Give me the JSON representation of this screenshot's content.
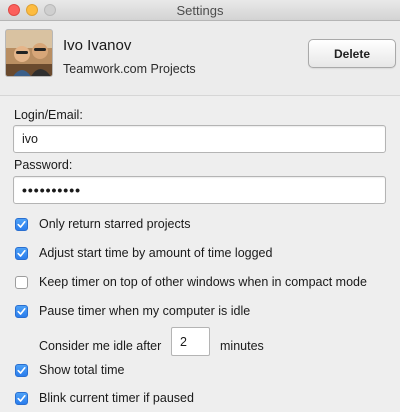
{
  "window": {
    "title": "Settings"
  },
  "user": {
    "name": "Ivo Ivanov",
    "company": "Teamwork.com Projects"
  },
  "header": {
    "delete_label": "Delete"
  },
  "form": {
    "login_label": "Login/Email:",
    "login_value": "ivo",
    "password_label": "Password:",
    "password_value": "••••••••••"
  },
  "options": [
    {
      "label": "Only return starred projects",
      "checked": true
    },
    {
      "label": "Adjust start time by amount of time logged",
      "checked": true
    },
    {
      "label": "Keep timer on top of other windows when in compact mode",
      "checked": false
    },
    {
      "label": "Pause timer when my computer is idle",
      "checked": true
    },
    {
      "label": "Show total time",
      "checked": true
    },
    {
      "label": "Blink current timer if paused",
      "checked": true
    }
  ],
  "idle": {
    "prefix": "Consider me idle after",
    "value": "2",
    "unit": "minutes"
  },
  "colors": {
    "accent": "#2a7ded",
    "close": "#fc605c",
    "minimize": "#fdbc40"
  },
  "icons": {
    "check": "checkmark-icon"
  }
}
